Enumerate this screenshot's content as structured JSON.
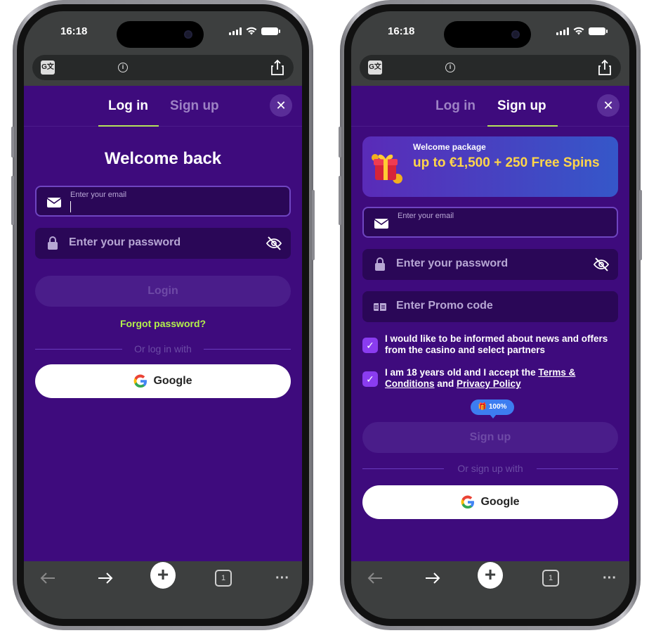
{
  "left_phone": {
    "status": {
      "time": "16:18"
    },
    "tabs": {
      "login": "Log in",
      "signup": "Sign up"
    },
    "title": "Welcome back",
    "email_label": "Enter your email",
    "password_placeholder": "Enter your password",
    "login_button": "Login",
    "forgot_password": "Forgot password?",
    "divider_text": "Or log in with",
    "google_button": "Google"
  },
  "right_phone": {
    "status": {
      "time": "16:18"
    },
    "tabs": {
      "login": "Log in",
      "signup": "Sign up"
    },
    "promo": {
      "label": "Welcome package",
      "offer": "up to €1,500 + 250 Free Spins"
    },
    "email_label": "Enter your email",
    "password_placeholder": "Enter your password",
    "promo_placeholder": "Enter Promo code",
    "consent_news": "I would like to be informed about news and offers from the casino and select partners",
    "consent_age_prefix": "I am 18 years old and I accept the ",
    "consent_terms_link": "Terms & Conditions",
    "consent_and": " and ",
    "consent_privacy_link": "Privacy Policy",
    "progress_badge": "100%",
    "signup_button": "Sign up",
    "divider_text": "Or sign up with",
    "google_button": "Google"
  },
  "browser": {
    "tab_count": "1"
  },
  "colors": {
    "page_bg": "#3e0b7d",
    "accent_green": "#b3f04a",
    "checkbox": "#8a3cf0",
    "promo_yellow": "#ffd54a"
  },
  "icons": [
    "translate-icon",
    "info-icon",
    "share-icon",
    "close-icon",
    "mail-icon",
    "lock-icon",
    "eye-off-icon",
    "google-icon",
    "gift-icon",
    "promo-code-icon",
    "check-icon",
    "back-icon",
    "forward-icon",
    "plus-icon",
    "tabs-icon",
    "more-icon"
  ]
}
